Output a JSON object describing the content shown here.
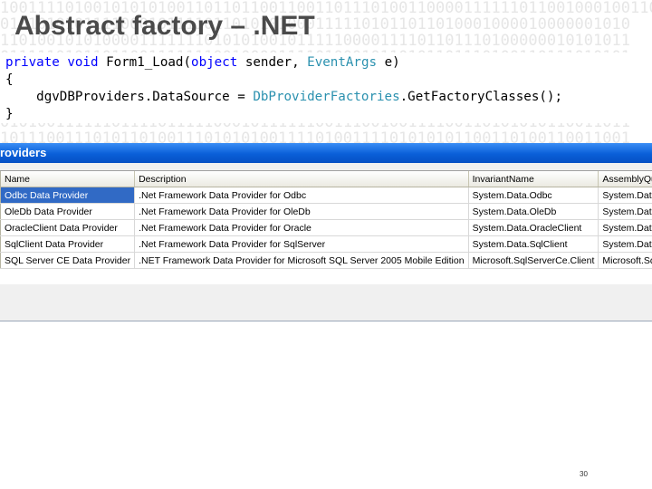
{
  "slide": {
    "title": "Abstract factory – .NET",
    "number": "30"
  },
  "code": {
    "line1": {
      "kw1": "private",
      "kw2": "void",
      "method": "Form1_Load(",
      "kw3": "object",
      "param1": " sender, ",
      "type1": "EventArgs",
      "param2": " e)"
    },
    "line2": "{",
    "line3": {
      "indent": "    dgvDBProviders.DataSource = ",
      "type": "DbProviderFactories",
      "rest": ".GetFactoryClasses();"
    },
    "line4": "}"
  },
  "window": {
    "title": "roviders",
    "columns": [
      "Name",
      "Description",
      "InvariantName",
      "AssemblyQualifie"
    ],
    "rows": [
      [
        "Odbc Data Provider",
        ".Net Framework Data Provider for Odbc",
        "System.Data.Odbc",
        "System.Data.Odb"
      ],
      [
        "OleDb Data Provider",
        ".Net Framework Data Provider for OleDb",
        "System.Data.OleDb",
        "System.Data.Ole"
      ],
      [
        "OracleClient Data Provider",
        ".Net Framework Data Provider for Oracle",
        "System.Data.OracleClient",
        "System.Data.Ora"
      ],
      [
        "SqlClient Data Provider",
        ".Net Framework Data Provider for SqlServer",
        "System.Data.SqlClient",
        "System.Data.Sql"
      ],
      [
        "SQL Server CE Data Provider",
        ".NET Framework Data Provider for Microsoft SQL Server 2005 Mobile Edition",
        "Microsoft.SqlServerCe.Client",
        "Microsoft.SqlSer"
      ]
    ]
  },
  "colors": {
    "keyword": "#0000ff",
    "type": "#2b91af",
    "selection": "#316ac5",
    "titlebar": "#0a5fd8"
  }
}
